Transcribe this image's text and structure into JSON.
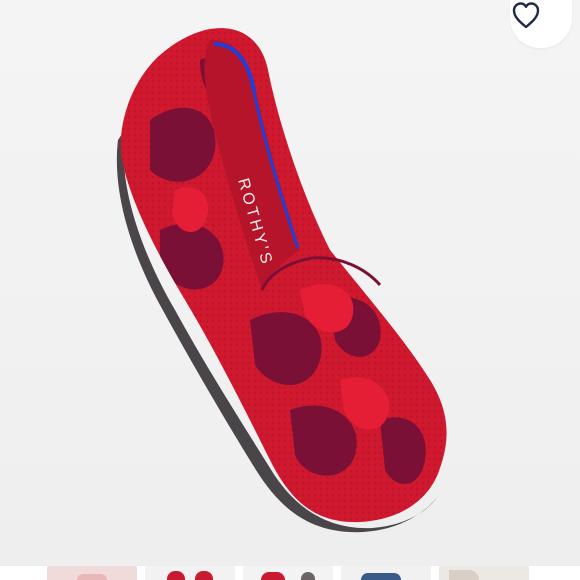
{
  "product": {
    "insole_brand_text": "ROTHY'S",
    "colors": {
      "knit_red": "#d0192f",
      "knit_bright_red": "#e51e36",
      "knit_dark_purple": "#7a1035",
      "trim_blue": "#1e3fd8",
      "sole_gray": "#4a4548",
      "background": "#f2f2f2"
    }
  },
  "favorite": {
    "icon": "heart-outline-icon"
  },
  "thumbnails": [
    {
      "name": "thumb-shoe-pink",
      "color": "#f0dada"
    },
    {
      "name": "thumb-shoe-red-pair",
      "color": "#f2f2f2"
    },
    {
      "name": "thumb-shoe-red-side",
      "color": "#f3f3f3"
    },
    {
      "name": "thumb-shoe-denim",
      "color": "#f1f1f1"
    },
    {
      "name": "thumb-shoe-worn",
      "color": "#ece8e4"
    }
  ]
}
